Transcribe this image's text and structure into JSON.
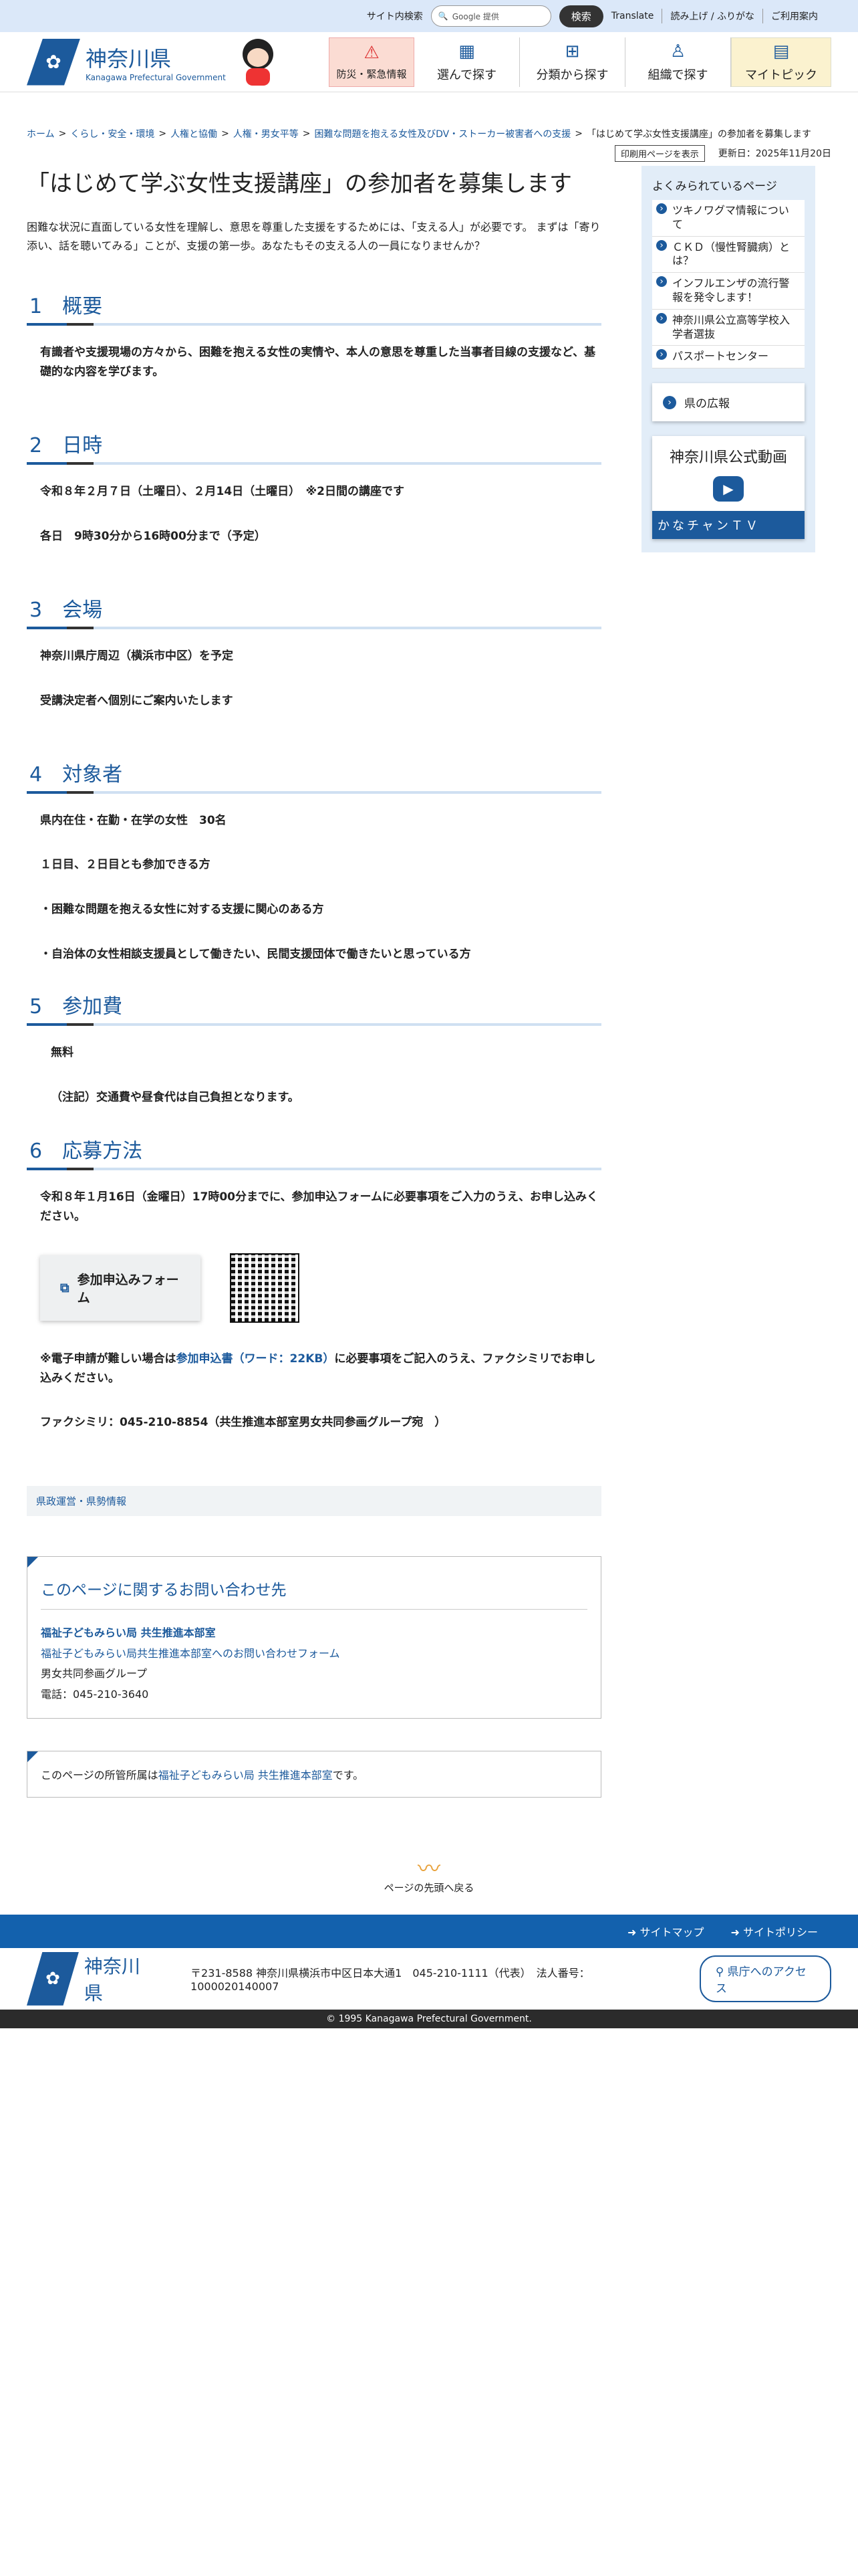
{
  "topbar": {
    "search_label": "サイト内検索",
    "search_placeholder": "Google 提供",
    "search_button": "検索",
    "translate": "Translate",
    "read_aloud": "読み上げ / ふりがな",
    "guide": "ご利用案内"
  },
  "header": {
    "logo_jp": "神奈川県",
    "logo_en": "Kanagawa Prefectural Government",
    "nav": [
      {
        "label": "防災・緊急情報",
        "icon": "warning-icon"
      },
      {
        "label": "選んで探す",
        "icon": "grid-icon"
      },
      {
        "label": "分類から探す",
        "icon": "hierarchy-icon"
      },
      {
        "label": "組織で探す",
        "icon": "org-icon"
      },
      {
        "label": "マイトピック",
        "icon": "book-icon"
      }
    ]
  },
  "breadcrumb": [
    {
      "label": "ホーム"
    },
    {
      "label": "くらし・安全・環境"
    },
    {
      "label": "人権と協働"
    },
    {
      "label": "人権・男女平等"
    },
    {
      "label": "困難な問題を抱える女性及びDV・ストーカー被害者への支援"
    },
    {
      "label": "「はじめて学ぶ女性支援講座」の参加者を募集します"
    }
  ],
  "meta": {
    "print": "印刷用ページを表示",
    "updated": "更新日：2025年11月20日"
  },
  "article": {
    "title": "「はじめて学ぶ女性支援講座」の参加者を募集します",
    "lead": "困難な状況に直面している女性を理解し、意思を尊重した支援をするためには、「支える人」が必要です。 まずは「寄り添い、話を聴いてみる」ことが、支援の第一歩。あなたもその支える人の一員になりませんか？",
    "s1": {
      "h": "1　概要",
      "p": [
        "有識者や支援現場の方々から、困難を抱える女性の実情や、本人の意思を尊重した当事者目線の支援など、基礎的な内容を学びます。"
      ]
    },
    "s2": {
      "h": "2　日時",
      "p": [
        "令和８年２月７日（土曜日）、２月14日（土曜日）　※2日間の講座です",
        "各日　9時30分から16時00分まで（予定）"
      ]
    },
    "s3": {
      "h": "3　会場",
      "p": [
        "神奈川県庁周辺（横浜市中区）を予定",
        "受講決定者へ個別にご案内いたします"
      ]
    },
    "s4": {
      "h": "4　対象者",
      "p": [
        "県内在住・在勤・在学の女性　30名",
        "１日目、２日目とも参加できる方",
        "・困難な問題を抱える女性に対する支援に関心のある方",
        "・自治体の女性相談支援員として働きたい、民間支援団体で働きたいと思っている方"
      ]
    },
    "s5": {
      "h": "5　参加費",
      "p": [
        "無料",
        "（注記）交通費や昼食代は自己負担となります。"
      ]
    },
    "s6": {
      "h": "6　応募方法",
      "p1": "令和８年１月16日（金曜日）17時00分までに、参加申込フォームに必要事項をご入力のうえ、お申し込みください。",
      "form_button": "参加申込みフォーム",
      "fax_pre": "※電子申請が難しい場合は",
      "fax_link": "参加申込書（ワード：22KB）",
      "fax_post": "に必要事項をご記入のうえ、ファクシミリでお申し込みください。",
      "fax": "ファクシミリ：045-210-8854（共生推進本部室男女共同参画グループ宛　）"
    }
  },
  "category": "県政運営・県勢情報",
  "contact": {
    "title": "このページに関するお問い合わせ先",
    "dept": "福祉子どもみらい局 共生推進本部室",
    "form": "福祉子どもみらい局共生推進本部室へのお問い合わせフォーム",
    "group": "男女共同参画グループ",
    "tel": "電話：045-210-3640"
  },
  "dept_note": {
    "pre": "このページの所管所属は",
    "link": "福祉子どもみらい局 共生推進本部室",
    "post": "です。"
  },
  "pagetop": "ページの先頭へ戻る",
  "sidebar": {
    "title": "よくみられているページ",
    "items": [
      "ツキノワグマ情報について",
      "ＣＫＤ（慢性腎臓病）とは？",
      "インフルエンザの流行警報を発令します！",
      "神奈川県公立高等学校入学者選抜",
      "パスポートセンター"
    ],
    "koho": "県の広報",
    "video_title": "神奈川県公式動画",
    "video_bar": "かなチャンＴＶ"
  },
  "footer": {
    "sitemap": "サイトマップ",
    "policy": "サイトポリシー",
    "logo": "神奈川県",
    "address": "〒231-8588 神奈川県横浜市中区日本大通1　045-210-1111（代表）　法人番号：1000020140007",
    "access": "県庁へのアクセス",
    "copyright": "© 1995 Kanagawa Prefectural Government."
  }
}
